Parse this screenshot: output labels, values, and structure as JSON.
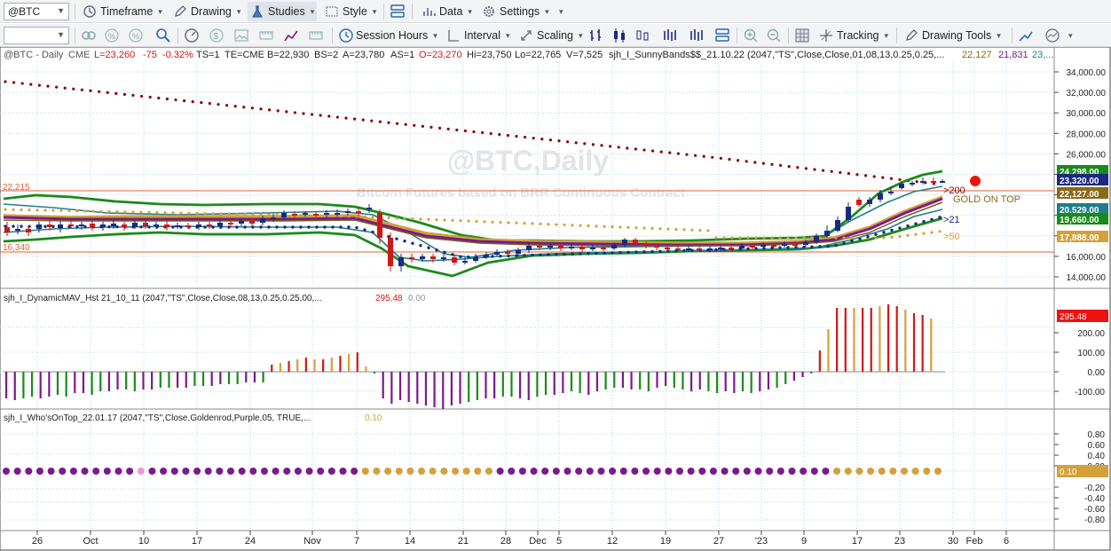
{
  "toolbar1": {
    "symbol": "@BTC",
    "timeframe": "Timeframe",
    "drawing": "Drawing",
    "studies": "Studies",
    "style": "Style",
    "data": "Data",
    "settings": "Settings"
  },
  "toolbar2": {
    "session_hours": "Session Hours",
    "interval": "Interval",
    "scaling": "Scaling",
    "tracking": "Tracking",
    "drawing_tools": "Drawing Tools"
  },
  "status": {
    "symbol": "@BTC - Daily",
    "exchange": "CME",
    "last": "L=23,260",
    "chg": "-75",
    "pct": "-0.32%",
    "ts": "TS=1",
    "te": "TE=CME",
    "bid": "B=22,930",
    "bs": "BS=2",
    "ask": "A=23,780",
    "as": "AS=1",
    "open": "O=23,270",
    "hi": "Hi=23,750",
    "lo": "Lo=22,765",
    "vol": "V=7,525",
    "study": "sjh_I_SunnyBands$$_21.10.22 (2047,\"TS\",Close,Close,01,08,13,0.25,0.25,...",
    "v1": "22,127",
    "v2": "21,831",
    "v3": "23,..."
  },
  "watermark": {
    "title": "@BTC,Daily",
    "subtitle": "Bitcoin Futures based on BRR Continuous Contract"
  },
  "price_pane": {
    "line_high_label": "22,215",
    "line_low_label": "16,340",
    "annot_200": ">200",
    "annot_gold": "GOLD ON TOP",
    "annot_21": ">21",
    "annot_50": ">50",
    "axis_labels": [
      "34,000.00",
      "32,000.00",
      "30,000.00",
      "28,000.00",
      "26,000.00",
      "24,000.00",
      "22,000.00",
      "20,000.00",
      "18,000.00",
      "16,000.00",
      "14,000.00"
    ],
    "tags": [
      {
        "text": "24,298.00",
        "color": "#1a8a1a"
      },
      {
        "text": "23,320.00",
        "color": "#1b2a80"
      },
      {
        "text": "22,127.00",
        "color": "#8a6a18"
      },
      {
        "text": "20,529.00",
        "color": "#1f7d8c"
      },
      {
        "text": "19,660.00",
        "color": "#1a8a1a"
      },
      {
        "text": "17,888.00",
        "color": "#d4a03a"
      }
    ]
  },
  "hist_pane": {
    "title": "sjh_I_DynamicMAV_Hst 21_10_11 (2047,\"TS\",Close,Close,08,13,0.25,0.25,00,...",
    "v1": "295.48",
    "v2": "0.00",
    "axis_labels": [
      "200.00",
      "100.00",
      "0.00",
      "-100.00"
    ],
    "tag": "295.48"
  },
  "who_pane": {
    "title": "sjh_I_Who'sOnTop_22.01.17 (2047,\"TS\",Close,Goldenrod,Purple,05, TRUE,...",
    "v1": "0.10",
    "axis_labels": [
      "0.80",
      "0.60",
      "0.40",
      "0.20",
      "-0.20",
      "-0.40",
      "-0.60",
      "-0.80"
    ],
    "tag": "0.10"
  },
  "x_axis": [
    "26",
    "Oct",
    "10",
    "17",
    "24",
    "Nov",
    "7",
    "14",
    "21",
    "28",
    "Dec",
    "5",
    "12",
    "19",
    "27",
    "'23",
    "9",
    "17",
    "23",
    "30",
    "Feb",
    "6"
  ],
  "colors": {
    "up": "#1b2a80",
    "down": "#d41616",
    "green": "#1a8a1a",
    "purple": "#7a1a8c",
    "gold": "#d4a03a",
    "teal": "#1f7d8c",
    "darkred": "#8b0000"
  }
}
